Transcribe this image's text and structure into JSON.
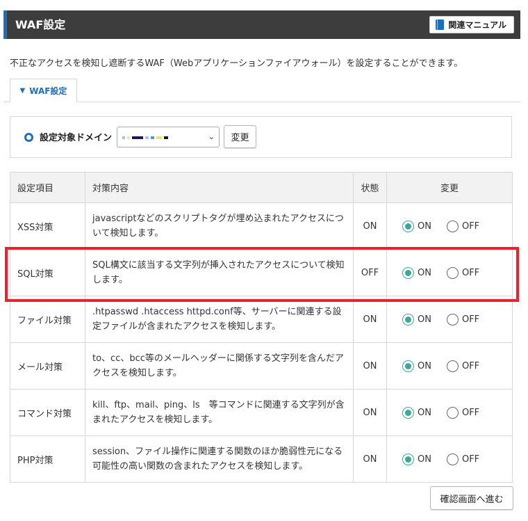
{
  "header": {
    "title": "WAF設定",
    "manual_label": "関連マニュアル"
  },
  "description": "不正なアクセスを検知し遮断するWAF（Webアプリケーションファイアウォール）を設定することができます。",
  "tab": {
    "label": "WAF設定"
  },
  "domain": {
    "label": "設定対象ドメイン",
    "selected_value": "",
    "change_label": "変更"
  },
  "table": {
    "headers": [
      "設定項目",
      "対策内容",
      "状態",
      "変更"
    ],
    "on_label": "ON",
    "off_label": "OFF",
    "rows": [
      {
        "item": "XSS対策",
        "desc": "javascriptなどのスクリプトタグが埋め込まれたアクセスについて検知します。",
        "status": "ON",
        "selected": "ON"
      },
      {
        "item": "SQL対策",
        "desc": "SQL構文に該当する文字列が挿入されたアクセスについて検知します。",
        "status": "OFF",
        "selected": "ON"
      },
      {
        "item": "ファイル対策",
        "desc": ".htpasswd .htaccess httpd.conf等、サーバーに関連する設定ファイルが含まれたアクセスを検知します。",
        "status": "ON",
        "selected": "ON"
      },
      {
        "item": "メール対策",
        "desc": "to、cc、bcc等のメールヘッダーに関係する文字列を含んだアクセスを検知します。",
        "status": "ON",
        "selected": "ON"
      },
      {
        "item": "コマンド対策",
        "desc": "kill、ftp、mail、ping、ls　等コマンドに関連する文字列が含まれたアクセスを検知します。",
        "status": "ON",
        "selected": "ON"
      },
      {
        "item": "PHP対策",
        "desc": "session、ファイル操作に関連する関数のほか脆弱性元になる可能性の高い関数の含まれたアクセスを検知します。",
        "status": "ON",
        "selected": "ON"
      }
    ]
  },
  "confirm_label": "確認画面へ進む",
  "colors": {
    "header_bg": "#3d3d3d",
    "accent_blue": "#1f6fb8",
    "radio_selected": "#3aa89a",
    "highlight_red": "#e8232d"
  }
}
